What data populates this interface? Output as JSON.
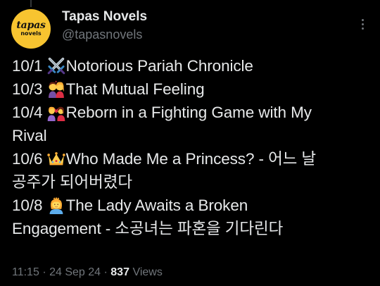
{
  "account": {
    "display_name": "Tapas Novels",
    "handle": "@tapasnovels",
    "avatar_text_top": "tapas",
    "avatar_text_bottom": "novels",
    "avatar_color": "#f7c430"
  },
  "tweet": {
    "lines": [
      {
        "date": "10/1",
        "emoji": "crossed-swords-icon",
        "text": "Notorious Pariah Chronicle"
      },
      {
        "date": "10/3",
        "emoji": "kiss-couple-icon",
        "text": "That Mutual Feeling"
      },
      {
        "date": "10/4",
        "emoji": "couple-with-heart-icon",
        "text": "Reborn in a Fighting Game with My"
      },
      {
        "text": "Rival"
      },
      {
        "date": "10/6",
        "emoji": "crown-icon",
        "text": "Who Made Me a Princess? - 어느 날"
      },
      {
        "text": "공주가 되어버렸다"
      },
      {
        "date": "10/8",
        "emoji": "princess-icon",
        "text": "The Lady Awaits a Broken"
      },
      {
        "text": "Engagement - 소공녀는 파혼을 기다린다"
      }
    ]
  },
  "meta": {
    "time": "11:15",
    "separator": "·",
    "date": "24 Sep 24",
    "views_count": "837",
    "views_label": "Views"
  },
  "colors": {
    "background": "#000000",
    "text": "#e7e9ea",
    "secondary_text": "#71767b"
  }
}
